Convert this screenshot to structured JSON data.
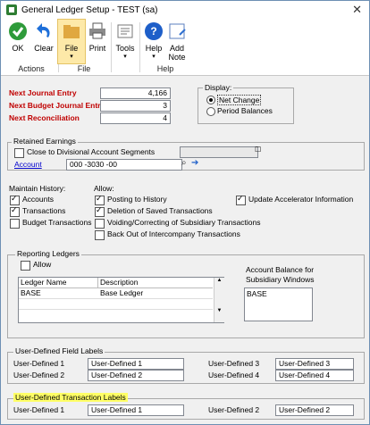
{
  "window": {
    "title": "General Ledger Setup  -  TEST (sa)"
  },
  "ribbon": {
    "ok": "OK",
    "clear": "Clear",
    "group_actions": "Actions",
    "file": "File",
    "print": "Print",
    "group_file": "File",
    "tools": "Tools",
    "help": "Help",
    "add_note": "Add Note",
    "group_help": "Help"
  },
  "numbers": {
    "next_journal_label": "Next Journal Entry",
    "next_journal_value": "4,166",
    "next_budget_label": "Next Budget Journal Entry",
    "next_budget_value": "3",
    "next_recon_label": "Next Reconciliation",
    "next_recon_value": "4"
  },
  "display": {
    "label": "Display:",
    "net_change": "Net Change",
    "period_balances": "Period Balances",
    "selected": "net_change"
  },
  "retained": {
    "title": "Retained Earnings",
    "close_to_div": "Close to Divisional Account Segments",
    "account_label": "Account",
    "account_value": "000 -3030 -00"
  },
  "maintain": {
    "title": "Maintain History:",
    "accounts": "Accounts",
    "transactions": "Transactions",
    "budget": "Budget Transactions"
  },
  "allow": {
    "title": "Allow:",
    "posting": "Posting to History",
    "deletion": "Deletion of Saved Transactions",
    "voiding": "Voiding/Correcting of Subsidiary Transactions",
    "backout": "Back Out of Intercompany Transactions"
  },
  "update_accel": "Update Accelerator Information",
  "reporting": {
    "title": "Reporting Ledgers",
    "allow": "Allow",
    "col_name": "Ledger Name",
    "col_desc": "Description",
    "rows": [
      {
        "name": "BASE",
        "desc": "Base Ledger"
      }
    ],
    "balance_label": "Account Balance for Subsidiary Windows",
    "balance_value": "BASE"
  },
  "udf": {
    "title": "User-Defined Field Labels",
    "l1": "User-Defined 1",
    "v1": "User-Defined 1",
    "l2": "User-Defined 2",
    "v2": "User-Defined 2",
    "l3": "User-Defined 3",
    "v3": "User-Defined 3",
    "l4": "User-Defined 4",
    "v4": "User-Defined 4"
  },
  "udt": {
    "title": "User-Defined Transaction Labels",
    "l1": "User-Defined 1",
    "v1": "User-Defined 1",
    "l2": "User-Defined 2",
    "v2": "User-Defined 2"
  },
  "colors": {
    "accent": "#c00000",
    "highlight": "#ffff66",
    "link": "#0000cc"
  }
}
